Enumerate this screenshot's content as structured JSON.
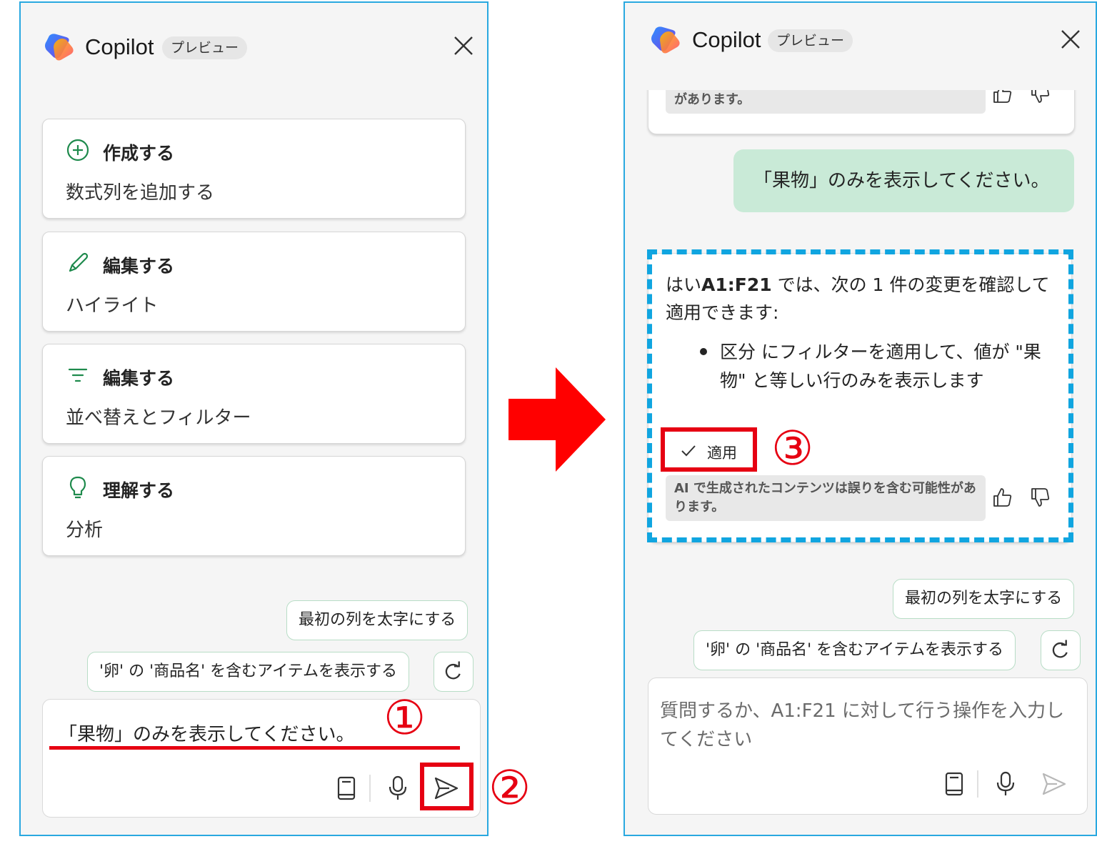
{
  "left_panel": {
    "header": {
      "title": "Copilot",
      "badge": "プレビュー"
    },
    "cards": [
      {
        "title": "作成する",
        "subtitle": "数式列を追加する",
        "icon": "plus-circle-icon"
      },
      {
        "title": "編集する",
        "subtitle": "ハイライト",
        "icon": "pen-icon"
      },
      {
        "title": "編集する",
        "subtitle": "並べ替えとフィルター",
        "icon": "filter-icon"
      },
      {
        "title": "理解する",
        "subtitle": "分析",
        "icon": "lightbulb-icon"
      }
    ],
    "suggestions": [
      "最初の列を太字にする",
      "'卵' の '商品名' を含むアイテムを表示する"
    ],
    "composer": {
      "text": "「果物」のみを表示してください。"
    }
  },
  "right_panel": {
    "header": {
      "title": "Copilot",
      "badge": "プレビュー"
    },
    "prev_disclaimer": "があります。",
    "user_message": "「果物」のみを表示してください。",
    "ai_response": {
      "intro_plain": "はい",
      "intro_bold": "A1:F21",
      "intro_rest": " では、次の 1 件の変更を確認して適用できます:",
      "bullet": "区分 にフィルターを適用して、値が \"果物\" と等しい行のみを表示します",
      "apply_label": "適用",
      "disclaimer": "AI で生成されたコンテンツは誤りを含む可能性があります。"
    },
    "suggestions": [
      "最初の列を太字にする",
      "'卵' の '商品名' を含むアイテムを表示する"
    ],
    "composer": {
      "placeholder": "質問するか、A1:F21 に対して行う操作を入力してください"
    }
  },
  "annotations": {
    "step1": "①",
    "step2": "②",
    "step3": "③"
  },
  "colors": {
    "accent_red": "#e60012",
    "panel_border": "#29a8e0",
    "dashed": "#10a5e0",
    "user_bubble": "#c9ead7"
  }
}
